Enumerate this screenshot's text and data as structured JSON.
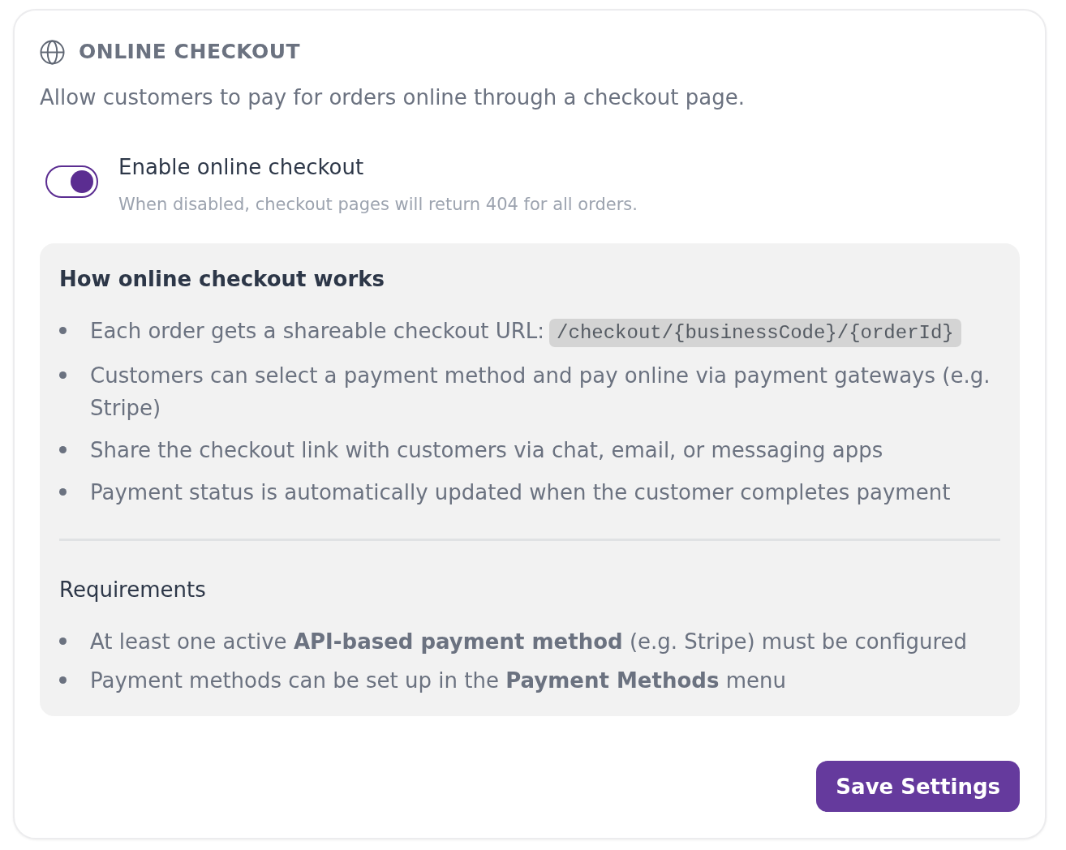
{
  "section": {
    "title": "ONLINE CHECKOUT",
    "description": "Allow customers to pay for orders online through a checkout page."
  },
  "toggle": {
    "label": "Enable online checkout",
    "hint": "When disabled, checkout pages will return 404 for all orders.",
    "on": true
  },
  "info_box": {
    "how_it_works": {
      "heading": "How online checkout works",
      "items": [
        {
          "text": "Each order gets a shareable checkout URL:",
          "code": "/checkout/{businessCode}/{orderId}"
        },
        {
          "text": "Customers can select a payment method and pay online via payment gateways (e.g. Stripe)"
        },
        {
          "text": "Share the checkout link with customers via chat, email, or messaging apps"
        },
        {
          "text": "Payment status is automatically updated when the customer completes payment"
        }
      ]
    },
    "requirements": {
      "heading": "Requirements",
      "items": [
        "At least one active **API-based payment method** (e.g. Stripe) must be configured",
        "Payment methods can be set up in the **Payment Methods** menu"
      ]
    }
  },
  "footer": {
    "save_button": "Save Settings"
  }
}
